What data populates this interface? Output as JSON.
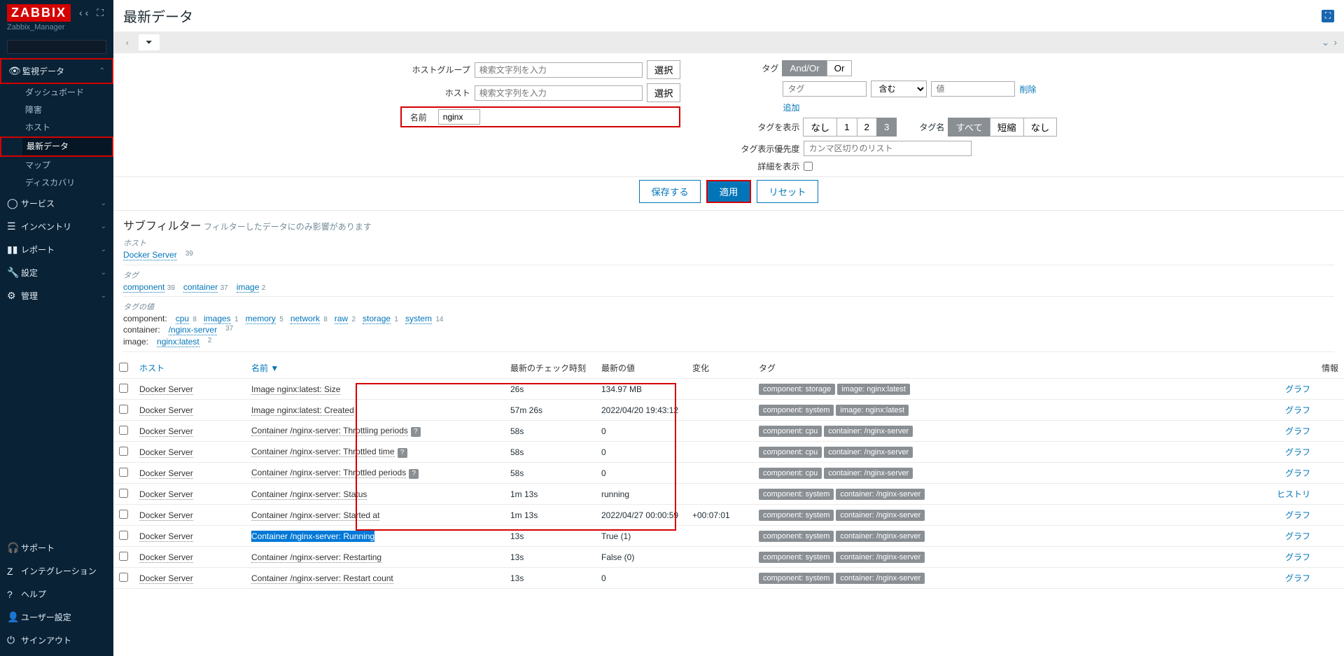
{
  "app": {
    "name": "ZABBIX",
    "server": "Zabbix_Manager"
  },
  "page_title": "最新データ",
  "nav": {
    "monitoring": {
      "label": "監視データ",
      "items": {
        "dashboard": "ダッシュボード",
        "problems": "障害",
        "hosts": "ホスト",
        "latest": "最新データ",
        "maps": "マップ",
        "discovery": "ディスカバリ"
      }
    },
    "services": "サービス",
    "inventory": "インベントリ",
    "reports": "レポート",
    "config": "設定",
    "admin": "管理",
    "support": "サポート",
    "integration": "インテグレーション",
    "help": "ヘルプ",
    "user": "ユーザー設定",
    "signout": "サインアウト"
  },
  "filter": {
    "hostgroup_label": "ホストグループ",
    "hostgroup_ph": "検索文字列を入力",
    "host_label": "ホスト",
    "host_ph": "検索文字列を入力",
    "name_label": "名前",
    "name_value": "nginx",
    "select_btn": "選択",
    "tags_label": "タグ",
    "andor": "And/Or",
    "or": "Or",
    "tag_ph": "タグ",
    "contains": "含む",
    "value_ph": "値",
    "delete": "削除",
    "add": "追加",
    "tagshow_label": "タグを表示",
    "none": "なし",
    "n1": "1",
    "n2": "2",
    "n3": "3",
    "tagname_label": "タグ名",
    "all": "すべて",
    "short": "短縮",
    "none2": "なし",
    "tagprio_label": "タグ表示優先度",
    "tagprio_ph": "カンマ区切りのリスト",
    "detail_label": "詳細を表示",
    "save": "保存する",
    "apply": "適用",
    "reset": "リセット"
  },
  "subfilter": {
    "title": "サブフィルター",
    "note": "フィルターしたデータにのみ影響があります",
    "hosts_label": "ホスト",
    "host_item": "Docker Server",
    "host_count": "39",
    "tags_label": "タグ",
    "tag_items": [
      {
        "name": "component",
        "count": "39"
      },
      {
        "name": "container",
        "count": "37"
      },
      {
        "name": "image",
        "count": "2"
      }
    ],
    "tagvalues_label": "タグの値",
    "tv": {
      "component_key": "component:",
      "component": [
        {
          "n": "cpu",
          "c": "8"
        },
        {
          "n": "images",
          "c": "1"
        },
        {
          "n": "memory",
          "c": "5"
        },
        {
          "n": "network",
          "c": "8"
        },
        {
          "n": "raw",
          "c": "2"
        },
        {
          "n": "storage",
          "c": "1"
        },
        {
          "n": "system",
          "c": "14"
        }
      ],
      "container_key": "container:",
      "container_name": "/nginx-server",
      "container_count": "37",
      "image_key": "image:",
      "image_name": "nginx:latest",
      "image_count": "2"
    }
  },
  "table": {
    "headers": {
      "cb": "",
      "host": "ホスト",
      "name": "名前 ▼",
      "last_check": "最新のチェック時刻",
      "last_value": "最新の値",
      "change": "変化",
      "tags": "タグ",
      "info": "情報",
      "graph": "グラフ",
      "history": "ヒストリ"
    },
    "rows": [
      {
        "host": "Docker Server",
        "name": "Image nginx:latest: Size",
        "q": false,
        "last_check": "26s",
        "last_value": "134.97 MB",
        "change": "",
        "tags": [
          "component: storage",
          "image: nginx:latest"
        ],
        "action": "graph"
      },
      {
        "host": "Docker Server",
        "name": "Image nginx:latest: Created",
        "q": false,
        "last_check": "57m 26s",
        "last_value": "2022/04/20 19:43:12",
        "change": "",
        "tags": [
          "component: system",
          "image: nginx:latest"
        ],
        "action": "graph"
      },
      {
        "host": "Docker Server",
        "name": "Container /nginx-server: Throttling periods",
        "q": true,
        "last_check": "58s",
        "last_value": "0",
        "change": "",
        "tags": [
          "component: cpu",
          "container: /nginx-server"
        ],
        "action": "graph"
      },
      {
        "host": "Docker Server",
        "name": "Container /nginx-server: Throttled time",
        "q": true,
        "last_check": "58s",
        "last_value": "0",
        "change": "",
        "tags": [
          "component: cpu",
          "container: /nginx-server"
        ],
        "action": "graph"
      },
      {
        "host": "Docker Server",
        "name": "Container /nginx-server: Throttled periods",
        "q": true,
        "last_check": "58s",
        "last_value": "0",
        "change": "",
        "tags": [
          "component: cpu",
          "container: /nginx-server"
        ],
        "action": "graph"
      },
      {
        "host": "Docker Server",
        "name": "Container /nginx-server: Status",
        "q": false,
        "last_check": "1m 13s",
        "last_value": "running",
        "change": "",
        "tags": [
          "component: system",
          "container: /nginx-server"
        ],
        "action": "history"
      },
      {
        "host": "Docker Server",
        "name": "Container /nginx-server: Started at",
        "q": false,
        "last_check": "1m 13s",
        "last_value": "2022/04/27 00:00:59",
        "change": "+00:07:01",
        "tags": [
          "component: system",
          "container: /nginx-server"
        ],
        "action": "graph"
      },
      {
        "host": "Docker Server",
        "name": "Container /nginx-server: Running",
        "q": false,
        "selected": true,
        "last_check": "13s",
        "last_value": "True (1)",
        "change": "",
        "tags": [
          "component: system",
          "container: /nginx-server"
        ],
        "action": "graph"
      },
      {
        "host": "Docker Server",
        "name": "Container /nginx-server: Restarting",
        "q": false,
        "last_check": "13s",
        "last_value": "False (0)",
        "change": "",
        "tags": [
          "component: system",
          "container: /nginx-server"
        ],
        "action": "graph"
      },
      {
        "host": "Docker Server",
        "name": "Container /nginx-server: Restart count",
        "q": false,
        "last_check": "13s",
        "last_value": "0",
        "change": "",
        "tags": [
          "component: system",
          "container: /nginx-server"
        ],
        "action": "graph"
      }
    ]
  }
}
